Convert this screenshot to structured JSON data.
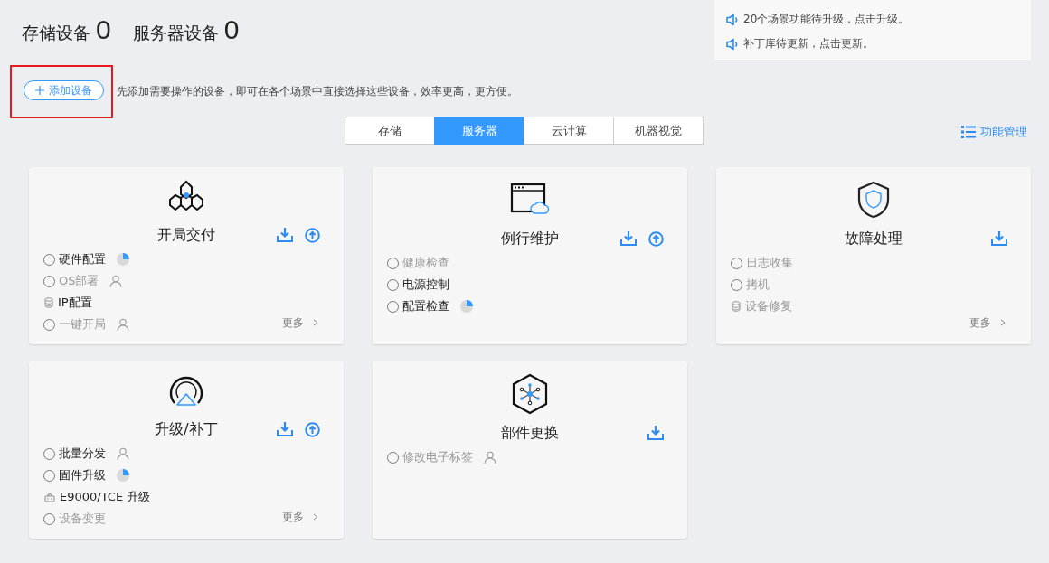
{
  "summary": [
    {
      "label": "存储设备",
      "count": "0"
    },
    {
      "label": "服务器设备",
      "count": "0"
    }
  ],
  "notices": [
    "20个场景功能待升级，点击升级。",
    "补丁库待更新，点击更新。"
  ],
  "add_button": {
    "label": "添加设备",
    "highlighted": true
  },
  "hint": "先添加需要操作的设备，即可在各个场景中直接选择这些设备，效率更高，更方便。",
  "tabs": [
    {
      "label": "存储",
      "selected": false
    },
    {
      "label": "服务器",
      "selected": true
    },
    {
      "label": "云计算",
      "selected": false
    },
    {
      "label": "机器视觉",
      "selected": false
    }
  ],
  "manage_link": "功能管理",
  "cards": [
    {
      "title": "开局交付",
      "kind": "hexagons",
      "download": true,
      "upload": true,
      "more": "更多",
      "items": [
        {
          "label": "硬件配置",
          "kind": "radio",
          "checked": false,
          "disabled": false,
          "progress": true,
          "user": false
        },
        {
          "label": "OS部署",
          "kind": "radio",
          "checked": false,
          "disabled": true,
          "progress": false,
          "user": true
        },
        {
          "label": "IP配置",
          "kind": "database",
          "disabled": false,
          "progress": false,
          "user": false
        },
        {
          "label": "一键开局",
          "kind": "radio",
          "checked": false,
          "disabled": true,
          "progress": false,
          "user": true
        }
      ]
    },
    {
      "title": "例行维护",
      "kind": "window",
      "download": true,
      "upload": true,
      "items": [
        {
          "label": "健康检查",
          "kind": "radio",
          "checked": false,
          "disabled": true,
          "progress": false,
          "user": false
        },
        {
          "label": "电源控制",
          "kind": "radio",
          "checked": false,
          "disabled": false,
          "progress": false,
          "user": false
        },
        {
          "label": "配置检查",
          "kind": "radio",
          "checked": false,
          "disabled": false,
          "progress": true,
          "user": false
        }
      ]
    },
    {
      "title": "故障处理",
      "kind": "shield",
      "download": true,
      "upload": false,
      "more": "更多",
      "items": [
        {
          "label": "日志收集",
          "kind": "radio",
          "checked": false,
          "disabled": true,
          "progress": false,
          "user": false
        },
        {
          "label": "拷机",
          "kind": "radio",
          "checked": false,
          "disabled": true,
          "progress": false,
          "user": false
        },
        {
          "label": "设备修复",
          "kind": "database",
          "disabled": true,
          "progress": false,
          "user": false
        }
      ]
    },
    {
      "title": "升级/补丁",
      "kind": "signal",
      "download": true,
      "upload": true,
      "more": "更多",
      "items": [
        {
          "label": "批量分发",
          "kind": "radio",
          "checked": false,
          "disabled": false,
          "progress": false,
          "user": true
        },
        {
          "label": "固件升级",
          "kind": "radio",
          "checked": false,
          "disabled": false,
          "progress": true,
          "user": false
        },
        {
          "label": "E9000/TCE 升级",
          "kind": "robot",
          "disabled": false,
          "progress": false,
          "user": false
        },
        {
          "label": "设备变更",
          "kind": "radio",
          "checked": false,
          "disabled": true,
          "progress": false,
          "user": false
        }
      ]
    },
    {
      "title": "部件更换",
      "kind": "network",
      "download": true,
      "upload": false,
      "items": [
        {
          "label": "修改电子标签",
          "kind": "radio",
          "checked": false,
          "disabled": true,
          "progress": false,
          "user": true
        }
      ]
    }
  ]
}
